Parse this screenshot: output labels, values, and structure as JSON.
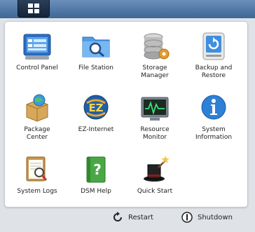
{
  "header": {
    "menu_button_icon": "grid-menu-icon"
  },
  "apps": [
    {
      "label": "Control Panel",
      "icon": "control-panel-icon"
    },
    {
      "label": "File Station",
      "icon": "folder-search-icon"
    },
    {
      "label": "Storage\nManager",
      "icon": "storage-disk-icon"
    },
    {
      "label": "Backup and\nRestore",
      "icon": "backup-drive-icon"
    },
    {
      "label": "Package\nCenter",
      "icon": "package-box-icon"
    },
    {
      "label": "EZ-Internet",
      "icon": "ez-internet-icon"
    },
    {
      "label": "Resource\nMonitor",
      "icon": "resource-monitor-icon"
    },
    {
      "label": "System\nInformation",
      "icon": "info-icon"
    },
    {
      "label": "System Logs",
      "icon": "logs-magnifier-icon"
    },
    {
      "label": "DSM Help",
      "icon": "help-book-icon"
    },
    {
      "label": "Quick Start",
      "icon": "magic-hat-icon"
    }
  ],
  "footer": {
    "restart_label": "Restart",
    "shutdown_label": "Shutdown",
    "restart_icon": "restart-icon",
    "shutdown_icon": "power-icon"
  },
  "colors": {
    "topbar": "#4f78a8",
    "panel": "#ffffff",
    "background": "#dfe3e8"
  }
}
